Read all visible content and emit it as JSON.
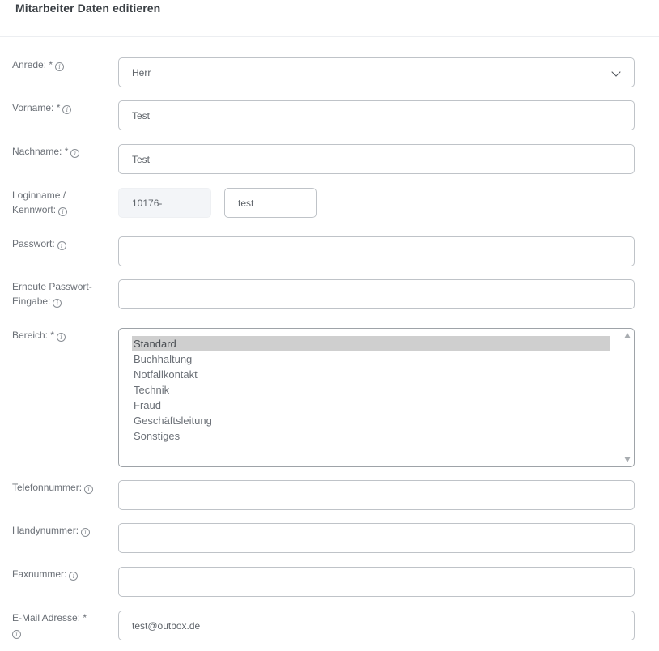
{
  "header": {
    "title": "Mitarbeiter Daten editieren"
  },
  "info_icon_glyph": "i",
  "fields": {
    "anrede": {
      "label": "Anrede: *",
      "value": "Herr"
    },
    "vorname": {
      "label": "Vorname: *",
      "value": "Test"
    },
    "nachname": {
      "label": "Nachname: *",
      "value": "Test"
    },
    "loginname": {
      "label_line1": "Loginname /",
      "label_line2": "Kennwort:",
      "prefix": "10176-",
      "value": "test"
    },
    "passwort": {
      "label": "Passwort:",
      "value": ""
    },
    "passwort_repeat": {
      "label_line1": "Erneute Passwort-",
      "label_line2": "Eingabe:",
      "value": ""
    },
    "bereich": {
      "label": "Bereich: *",
      "options": [
        "Standard",
        "Buchhaltung",
        "Notfallkontakt",
        "Technik",
        "Fraud",
        "Geschäftsleitung",
        "Sonstiges"
      ],
      "selected": "Standard"
    },
    "telefon": {
      "label": "Telefonnummer:",
      "value": ""
    },
    "handy": {
      "label": "Handynummer:",
      "value": ""
    },
    "fax": {
      "label": "Faxnummer:",
      "value": ""
    },
    "email": {
      "label": "E-Mail Adresse: *",
      "value": "test@outbox.de"
    }
  }
}
